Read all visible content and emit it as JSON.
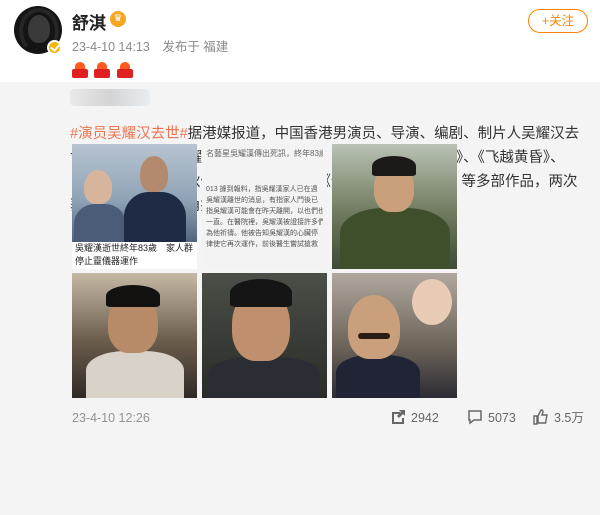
{
  "author": {
    "name": "舒淇",
    "timestamp": "23-4-10 14:13",
    "source": "发布于 福建"
  },
  "follow_button": {
    "label": "+关注"
  },
  "repost": {
    "hashtag": "#演员吴耀汉去世#",
    "text": "据港媒报道，中国香港男演员、导演、编剧、制片人吴耀汉去世，享年83岁。吴耀汉曾出演《五福星》系列、《炮制女朋友》、《飞越黄昏》、《猛男滚死队》、《狄仁杰之通天帝国》、《僵尸》、《风再起时》等多部作品，两次获金像奖最佳男主角提名。",
    "images": [
      {
        "icon": "photo-two-men",
        "caption": "吳耀漢逝世終年83歲　家人群\n停止靈儀器運作"
      },
      {
        "icon": "news-article",
        "headline": "名藝星吳耀漢傳出死訊，終年83歲。",
        "lines": "013 據到報料，指吳耀漢家人已在週\n吳耀漢離世的消息，有指家人門後已\n指吳耀漢可能會在昨天離開，以也們也\n一直。在醫院裡，吳耀漢被證接許多們\n為他祈禱。他被告知吳耀漢的心臟停\n律使它再次運作，前後醫生嘗試搶救"
      },
      {
        "icon": "photo-portrait-green"
      },
      {
        "icon": "photo-film-still-1"
      },
      {
        "icon": "photo-film-still-2"
      },
      {
        "icon": "photo-mustache-baby"
      }
    ],
    "posted": "23-4-10 12:26",
    "reposts": "2942",
    "comments": "5073",
    "likes": "3.5万"
  },
  "colors": {
    "accent_orange": "#ff8200",
    "hashtag": "#eb7350",
    "repost_bg": "#f4f4f4"
  }
}
